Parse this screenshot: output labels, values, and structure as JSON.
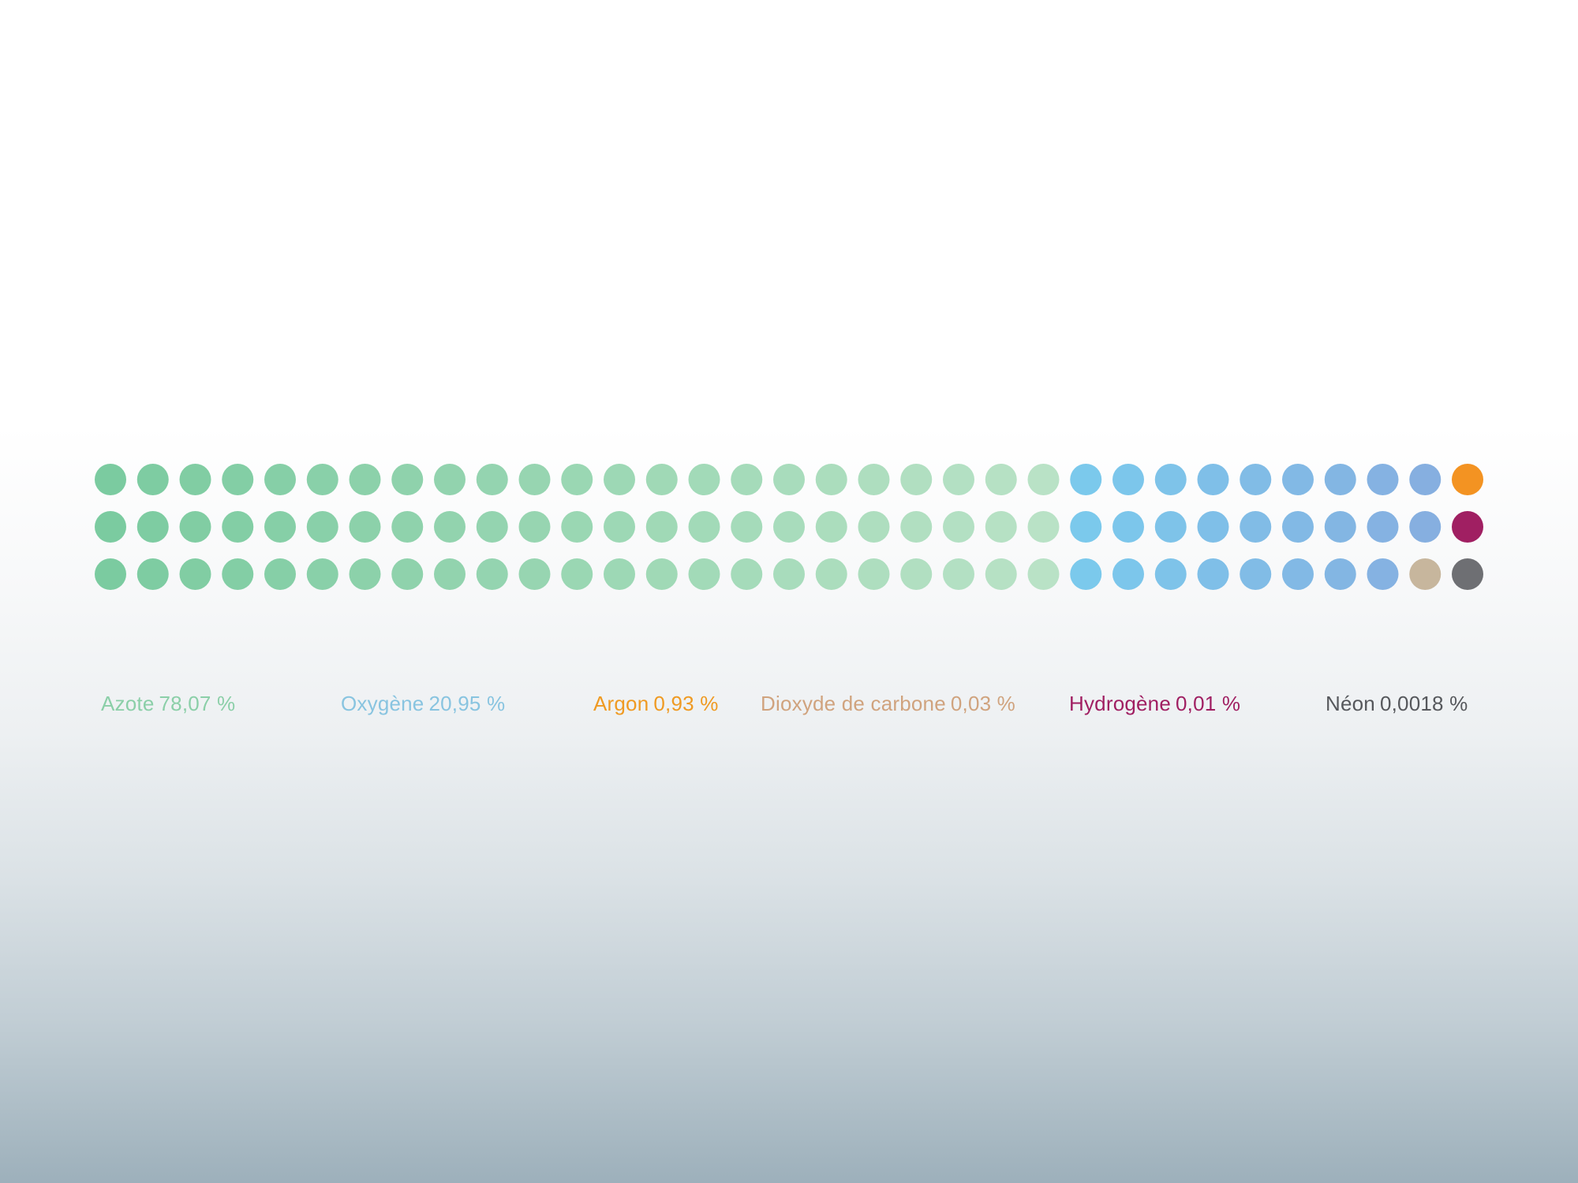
{
  "chart_data": {
    "type": "waffle",
    "grid": {
      "rows": 3,
      "columns": 33
    },
    "categories": [
      {
        "name": "Azote",
        "value": "78,07 %",
        "percent": 78.07,
        "dots": 69,
        "colors": [
          "#7bcba0",
          "#b9e2c6"
        ],
        "label_color": "#8bcfa8"
      },
      {
        "name": "Oxygène",
        "value": "20,95 %",
        "percent": 20.95,
        "dots": 26,
        "colors": [
          "#7bc9ec",
          "#86afe0"
        ],
        "label_color": "#88c4e0"
      },
      {
        "name": "Argon",
        "value": "0,93 %",
        "percent": 0.93,
        "dots": 1,
        "colors": [
          "#f39322"
        ],
        "label_color": "#ef9a22"
      },
      {
        "name": "Dioxyde de carbone",
        "value": "0,03 %",
        "percent": 0.03,
        "dots": 1,
        "colors": [
          "#c7b69d"
        ],
        "label_color": "#d0a37e"
      },
      {
        "name": "Hydrogène",
        "value": "0,01 %",
        "percent": 0.01,
        "dots": 1,
        "colors": [
          "#a01f62"
        ],
        "label_color": "#a01f62"
      },
      {
        "name": "Néon",
        "value": "0,0018 %",
        "percent": 0.0018,
        "dots": 1,
        "colors": [
          "#6e6f73"
        ],
        "label_color": "#56585c"
      }
    ]
  }
}
